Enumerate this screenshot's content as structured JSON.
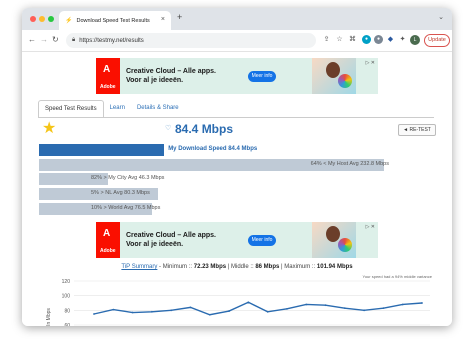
{
  "browser": {
    "tab_title": "Download Speed Test Results",
    "tab_close": "×",
    "new_tab": "+",
    "url": "https://testmy.net/results",
    "update_label": "Update",
    "avatar_letter": "L"
  },
  "ads": {
    "logo_word": "Adobe",
    "line1": "Creative Cloud – Alle apps.",
    "line2": "Voor al je ideeën.",
    "button": "Meer info"
  },
  "tabs": [
    "Speed Test Results",
    "Learn",
    "Details & Share"
  ],
  "result": {
    "speed": "84.4 Mbps",
    "retest_label": "◄ RE-TEST"
  },
  "bars": [
    {
      "label": "My Download Speed 84.4 Mbps",
      "value": 84.4,
      "primary": true
    },
    {
      "label": "64% < My Host Avg 232.8 Mbps",
      "value": 232.8,
      "primary": false
    },
    {
      "label": "82% > My City Avg 46.3 Mbps",
      "value": 46.3,
      "primary": false
    },
    {
      "label": "5% > NL Avg 80.3 Mbps",
      "value": 80.3,
      "primary": false
    },
    {
      "label": "10% > World Avg 76.5 Mbps",
      "value": 76.5,
      "primary": false
    }
  ],
  "summary": {
    "link": "TiP Summary",
    "minimum_label": " - Minimum :: ",
    "minimum": "72.23 Mbps",
    "middle_label": " | Middle :: ",
    "middle": "86 Mbps",
    "maximum_label": " | Maximum :: ",
    "maximum": "101.94 Mbps",
    "note": "Your speed had a 94% middle variance"
  },
  "chart_data": {
    "type": "line",
    "ylabel": "In Mbps",
    "yticks": [
      60,
      80,
      100,
      120
    ],
    "ylim": [
      60,
      120
    ],
    "values": [
      75,
      81,
      77,
      78,
      80,
      84,
      74,
      79,
      91,
      78,
      82,
      88,
      87,
      83,
      80,
      83,
      88,
      90
    ]
  },
  "colors": {
    "accent": "#2a6bb0",
    "bar_gray": "#bfcad6",
    "ad_bg": "#ddf0e9",
    "adobe_red": "#fa0f00",
    "update_red": "#d9534f"
  }
}
